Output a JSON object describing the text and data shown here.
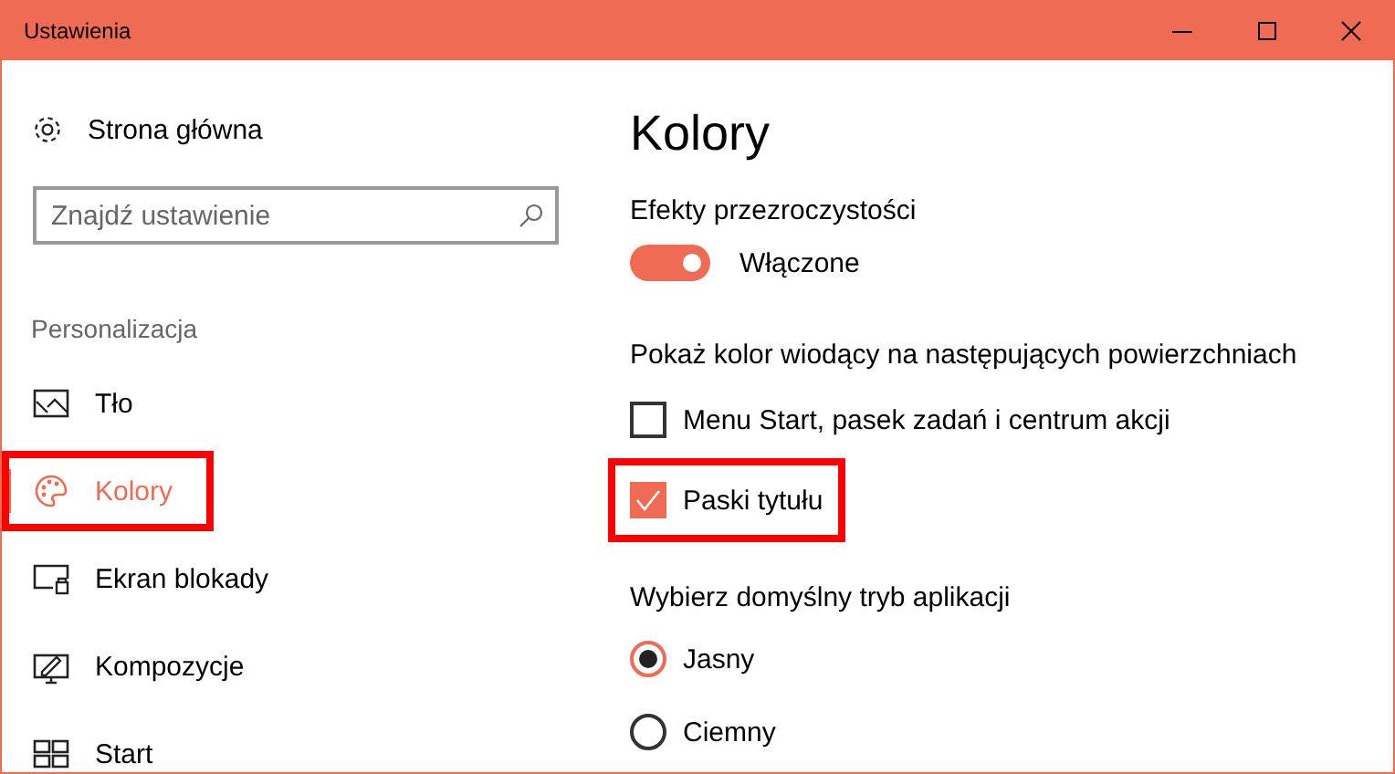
{
  "window": {
    "title": "Ustawienia"
  },
  "sidebar": {
    "home": "Strona główna",
    "search": {
      "placeholder": "Znajdź ustawienie"
    },
    "section": "Personalizacja",
    "items": [
      {
        "label": "Tło",
        "selected": false,
        "highlighted": false
      },
      {
        "label": "Kolory",
        "selected": true,
        "highlighted": true
      },
      {
        "label": "Ekran blokady",
        "selected": false,
        "highlighted": false
      },
      {
        "label": "Kompozycje",
        "selected": false,
        "highlighted": false
      },
      {
        "label": "Start",
        "selected": false,
        "highlighted": false
      }
    ]
  },
  "content": {
    "title": "Kolory",
    "transparency": {
      "label": "Efekty przezroczystości",
      "on": true,
      "state": "Włączone"
    },
    "accent_surfaces": {
      "label": "Pokaż kolor wiodący na następujących powierzchniach",
      "options": [
        {
          "label": "Menu Start, pasek zadań i centrum akcji",
          "checked": false,
          "highlighted": false
        },
        {
          "label": "Paski tytułu",
          "checked": true,
          "highlighted": true
        }
      ]
    },
    "app_mode": {
      "label": "Wybierz domyślny tryb aplikacji",
      "options": [
        {
          "label": "Jasny",
          "selected": true
        },
        {
          "label": "Ciemny",
          "selected": false
        }
      ]
    }
  }
}
